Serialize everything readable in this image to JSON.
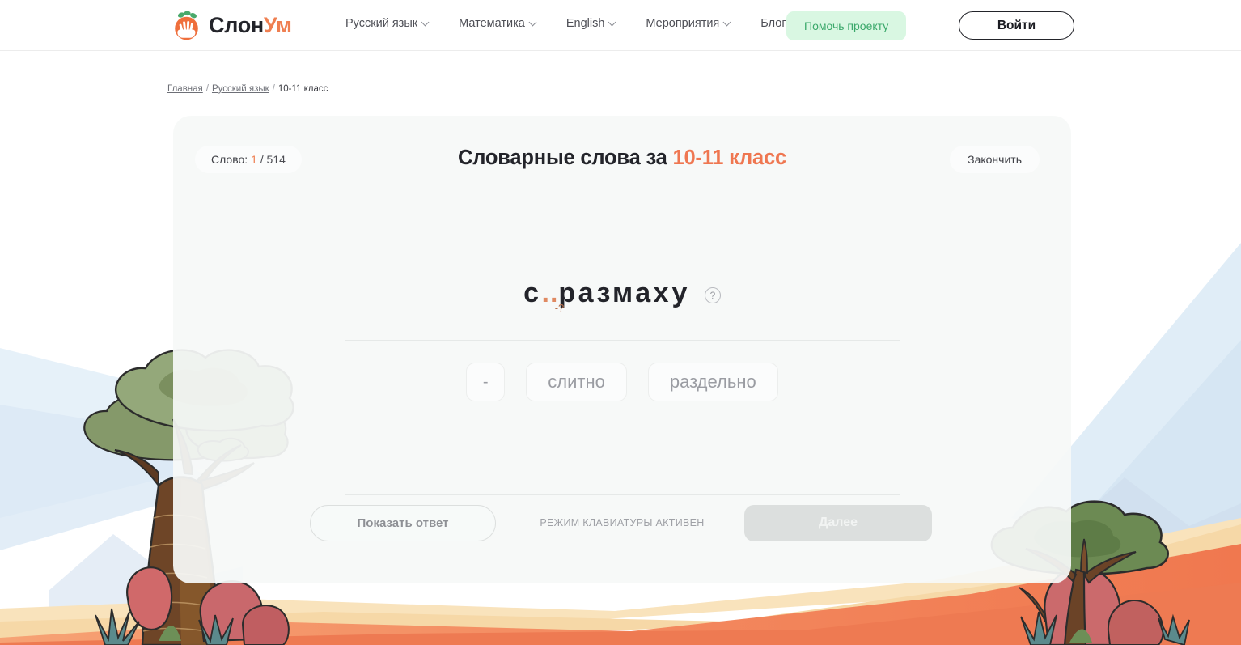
{
  "header": {
    "logo": {
      "text_main": "Слон",
      "text_accent": "Ум",
      "icon": "elephant-palm-logo-icon"
    },
    "nav": [
      {
        "label": "Русский язык",
        "has_caret": true
      },
      {
        "label": "Математика",
        "has_caret": true
      },
      {
        "label": "English",
        "has_caret": true
      },
      {
        "label": "Мероприятия",
        "has_caret": true
      },
      {
        "label": "Блог",
        "has_caret": false
      }
    ],
    "help_project_label": "Помочь проекту",
    "login_label": "Войти"
  },
  "breadcrumb": {
    "home": "Главная",
    "sep1": "/",
    "subject": "Русский язык",
    "sep2": "/",
    "current": "10-11 класс"
  },
  "card": {
    "counter": {
      "label": "Слово:",
      "current": "1",
      "separator": "/",
      "total": "514"
    },
    "title_main": "Словарные слова за",
    "title_grade": "10-11 класс",
    "finish_label": "Закончить",
    "task": {
      "word_prefix": "с",
      "gap": "..",
      "gap_hint": "-?",
      "word_suffix": "размаху",
      "help_icon": "question-circle-icon"
    },
    "options": [
      {
        "label": "-"
      },
      {
        "label": "слитно"
      },
      {
        "label": "раздельно"
      }
    ],
    "controls": {
      "show_answer_label": "Показать ответ",
      "keyboard_mode_label": "РЕЖИМ КЛАВИАТУРЫ АКТИВЕН",
      "next_label": "Далее"
    }
  },
  "colors": {
    "accent_orange": "#ef7751",
    "help_green_bg": "#d9f7e2",
    "help_green_text": "#3aa86a",
    "card_bg": "#f6f9f8",
    "sky": "#e4eff7",
    "sand": "#f7dfb2",
    "ground": "#f3855c"
  }
}
